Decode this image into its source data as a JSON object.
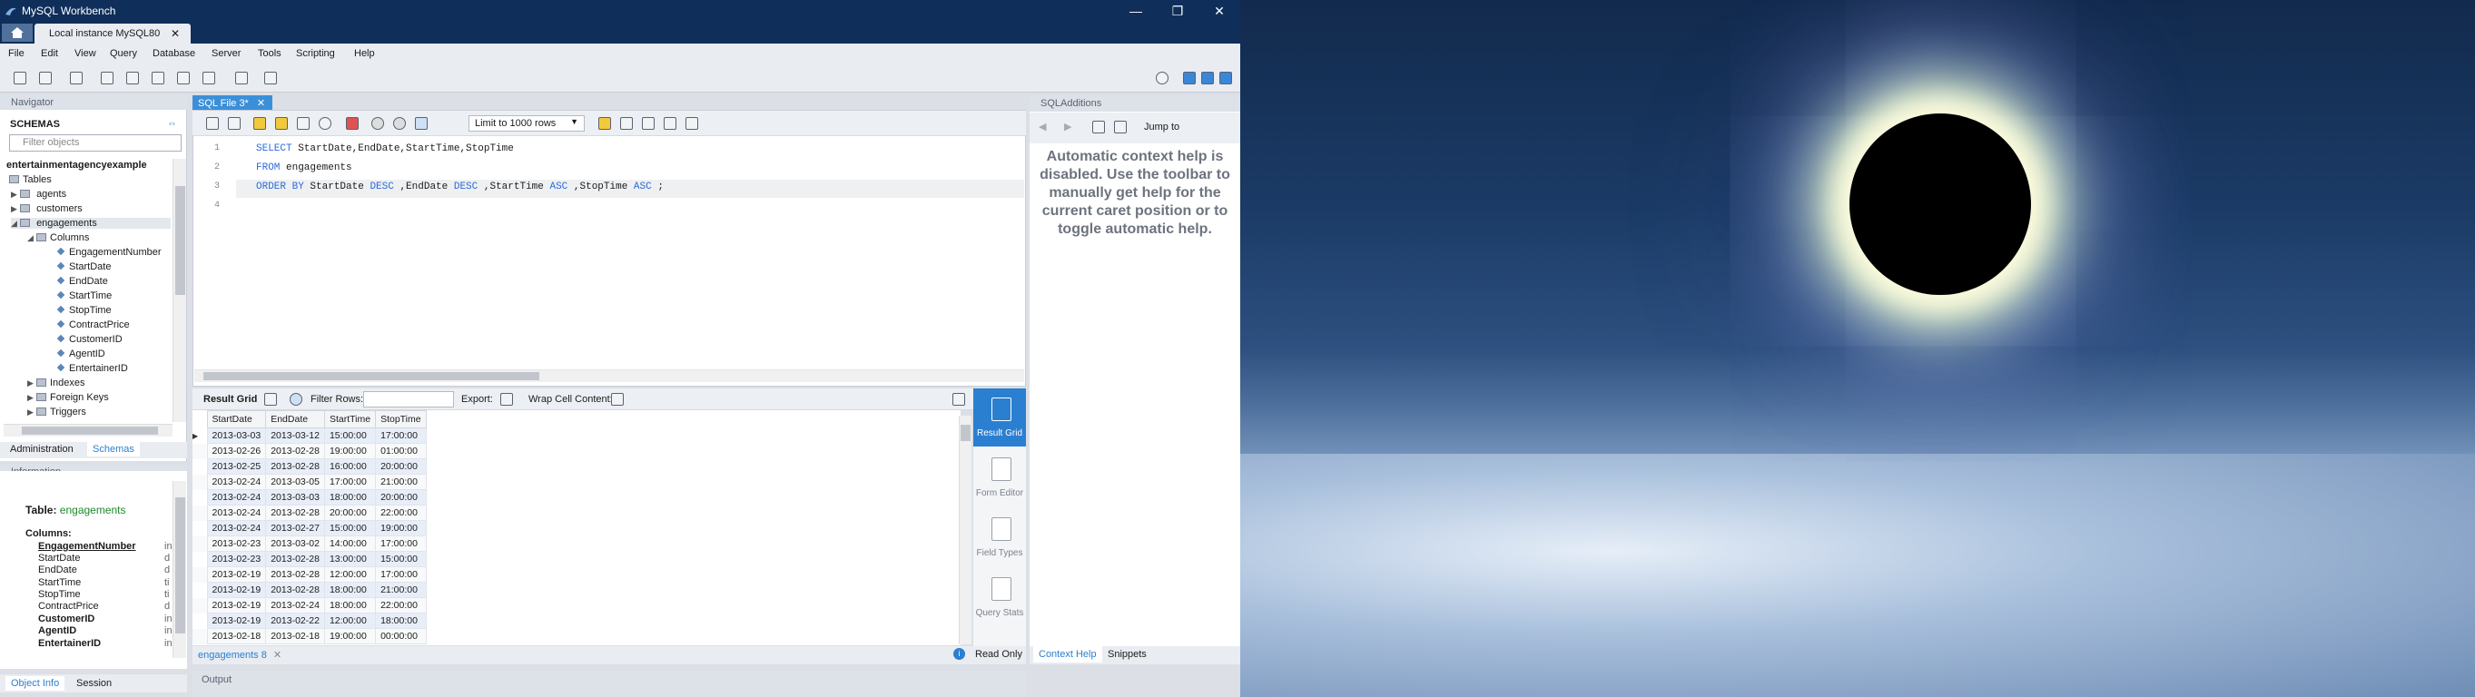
{
  "window": {
    "title": "MySQL Workbench",
    "controls": [
      "—",
      "❐",
      "✕"
    ]
  },
  "connection_tab": {
    "label": "Local instance MySQL80",
    "close": "✕"
  },
  "menu": [
    "File",
    "Edit",
    "View",
    "Query",
    "Database",
    "Server",
    "Tools",
    "Scripting",
    "Help"
  ],
  "navigator": {
    "header": "Navigator",
    "schemas_label": "SCHEMAS",
    "filter_placeholder": "Filter objects",
    "schema": "entertainmentagencyexample",
    "tables_label": "Tables",
    "tables": [
      "agents",
      "customers",
      "engagements"
    ],
    "columns_label": "Columns",
    "columns": [
      "EngagementNumber",
      "StartDate",
      "EndDate",
      "StartTime",
      "StopTime",
      "ContractPrice",
      "CustomerID",
      "AgentID",
      "EntertainerID"
    ],
    "other_nodes": [
      "Indexes",
      "Foreign Keys",
      "Triggers"
    ],
    "bottom_tabs": [
      "Administration",
      "Schemas"
    ]
  },
  "information": {
    "header": "Information",
    "table_label": "Table:",
    "table_name": "engagements",
    "columns_label": "Columns:",
    "columns": [
      {
        "name": "EngagementNumber",
        "bold": true,
        "type": "in"
      },
      {
        "name": "StartDate",
        "bold": false,
        "type": "d"
      },
      {
        "name": "EndDate",
        "bold": false,
        "type": "d"
      },
      {
        "name": "StartTime",
        "bold": false,
        "type": "ti"
      },
      {
        "name": "StopTime",
        "bold": false,
        "type": "ti"
      },
      {
        "name": "ContractPrice",
        "bold": false,
        "type": "d"
      },
      {
        "name": "CustomerID",
        "bold": true,
        "type": "in"
      },
      {
        "name": "AgentID",
        "bold": true,
        "type": "in"
      },
      {
        "name": "EntertainerID",
        "bold": true,
        "type": "in"
      }
    ],
    "bottom_tabs": [
      "Object Info",
      "Session"
    ]
  },
  "editor": {
    "tab": "SQL File 3*",
    "limit": "Limit to 1000 rows",
    "line_numbers": [
      "1",
      "2",
      "3",
      "4"
    ],
    "lines": [
      [
        {
          "t": "SELECT",
          "k": true
        },
        {
          "t": " StartDate,EndDate,StartTime,StopTime",
          "k": false
        }
      ],
      [
        {
          "t": "FROM",
          "k": true
        },
        {
          "t": " engagements",
          "k": false
        }
      ],
      [
        {
          "t": "ORDER BY",
          "k": true
        },
        {
          "t": " StartDate ",
          "k": false
        },
        {
          "t": "DESC",
          "k": true
        },
        {
          "t": " ,EndDate ",
          "k": false
        },
        {
          "t": "DESC",
          "k": true
        },
        {
          "t": " ,StartTime ",
          "k": false
        },
        {
          "t": "ASC",
          "k": true
        },
        {
          "t": " ,StopTime ",
          "k": false
        },
        {
          "t": "ASC",
          "k": true
        },
        {
          "t": " ;",
          "k": false
        }
      ],
      []
    ]
  },
  "results": {
    "label": "Result Grid",
    "filter_label": "Filter Rows:",
    "export_label": "Export:",
    "wrap_label": "Wrap Cell Content:",
    "columns": [
      "StartDate",
      "EndDate",
      "StartTime",
      "StopTime"
    ],
    "rows": [
      [
        "2013-03-03",
        "2013-03-12",
        "15:00:00",
        "17:00:00"
      ],
      [
        "2013-02-26",
        "2013-02-28",
        "19:00:00",
        "01:00:00"
      ],
      [
        "2013-02-25",
        "2013-02-28",
        "16:00:00",
        "20:00:00"
      ],
      [
        "2013-02-24",
        "2013-03-05",
        "17:00:00",
        "21:00:00"
      ],
      [
        "2013-02-24",
        "2013-03-03",
        "18:00:00",
        "20:00:00"
      ],
      [
        "2013-02-24",
        "2013-02-28",
        "20:00:00",
        "22:00:00"
      ],
      [
        "2013-02-24",
        "2013-02-27",
        "15:00:00",
        "19:00:00"
      ],
      [
        "2013-02-23",
        "2013-03-02",
        "14:00:00",
        "17:00:00"
      ],
      [
        "2013-02-23",
        "2013-02-28",
        "13:00:00",
        "15:00:00"
      ],
      [
        "2013-02-19",
        "2013-02-28",
        "12:00:00",
        "17:00:00"
      ],
      [
        "2013-02-19",
        "2013-02-28",
        "18:00:00",
        "21:00:00"
      ],
      [
        "2013-02-19",
        "2013-02-24",
        "18:00:00",
        "22:00:00"
      ],
      [
        "2013-02-19",
        "2013-02-22",
        "12:00:00",
        "18:00:00"
      ],
      [
        "2013-02-18",
        "2013-02-18",
        "19:00:00",
        "00:00:00"
      ]
    ],
    "side_buttons": [
      "Result Grid",
      "Form Editor",
      "Field Types",
      "Query Stats"
    ],
    "tab": "engagements 8",
    "read_only": "Read Only"
  },
  "output_label": "Output",
  "sql_additions": {
    "header": "SQLAdditions",
    "jump_to": "Jump to",
    "help_text": "Automatic context help is disabled. Use the toolbar to manually get help for the current caret position or to toggle automatic help.",
    "bottom_tabs": [
      "Context Help",
      "Snippets"
    ]
  }
}
